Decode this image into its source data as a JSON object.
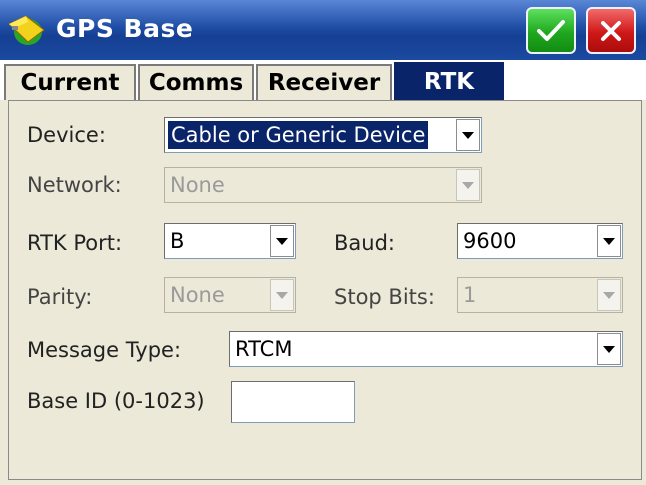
{
  "window": {
    "title": "GPS Base",
    "app_icon": "satellite-globe-icon",
    "ok_icon": "checkmark-icon",
    "close_icon": "close-x-icon"
  },
  "tabs": [
    {
      "label": "Current",
      "active": false
    },
    {
      "label": "Comms",
      "active": false
    },
    {
      "label": "Receiver",
      "active": false
    },
    {
      "label": "RTK",
      "active": true
    }
  ],
  "form": {
    "device": {
      "label": "Device:",
      "value": "Cable or Generic Device"
    },
    "network": {
      "label": "Network:",
      "value": "None",
      "enabled": false
    },
    "rtk_port": {
      "label": "RTK Port:",
      "value": "B"
    },
    "baud": {
      "label": "Baud:",
      "value": "9600"
    },
    "parity": {
      "label": "Parity:",
      "value": "None",
      "enabled": false
    },
    "stop_bits": {
      "label": "Stop Bits:",
      "value": "1",
      "enabled": false
    },
    "message_type": {
      "label": "Message Type:",
      "value": "RTCM"
    },
    "base_id": {
      "label": "Base ID (0-1023)",
      "value": ""
    }
  },
  "colors": {
    "titlebar": "#1f4ea6",
    "active_tab": "#0a246a",
    "ok_button": "#1fa81f",
    "close_button": "#d01818",
    "panel_bg": "#ece9d8"
  }
}
